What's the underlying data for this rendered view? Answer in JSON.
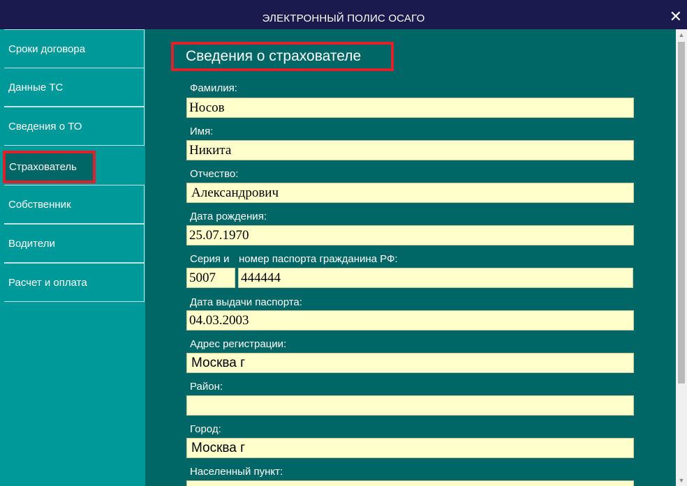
{
  "window": {
    "title": "ЭЛЕКТРОННЫЙ ПОЛИС ОСАГО",
    "close_glyph": "✕"
  },
  "sidebar": {
    "items": [
      {
        "label": "Сроки договора"
      },
      {
        "label": "Данные ТС"
      },
      {
        "label": "Сведения о ТО"
      },
      {
        "label": "Страхователь",
        "active": true
      },
      {
        "label": "Собственник"
      },
      {
        "label": "Водители"
      },
      {
        "label": "Расчет и оплата"
      }
    ]
  },
  "form": {
    "title": "Сведения о страхователе",
    "surname": {
      "label": "Фамилия:",
      "value": "Носов"
    },
    "name": {
      "label": "Имя:",
      "value": "Никита"
    },
    "patronymic": {
      "label": "Отчество:",
      "value": "Александрович"
    },
    "birth_date": {
      "label": "Дата рождения:",
      "value": "25.07.1970"
    },
    "passport": {
      "series_label": "Серия и",
      "number_label": "номер паспорта гражданина РФ:",
      "series": "5007",
      "number": "444444"
    },
    "passport_issue_date": {
      "label": "Дата выдачи паспорта:",
      "value": "04.03.2003"
    },
    "reg_address": {
      "label": "Адрес регистрации:",
      "value": "Москва г"
    },
    "district": {
      "label": "Район:",
      "value": ""
    },
    "city": {
      "label": "Город:",
      "value": "Москва г"
    },
    "settlement": {
      "label": "Населенный пункт:",
      "value": ""
    }
  },
  "colors": {
    "titlebar": "#1a1a4e",
    "sidebar": "#009999",
    "main": "#006666",
    "field": "#ffffcc",
    "highlight": "#e0202a"
  }
}
